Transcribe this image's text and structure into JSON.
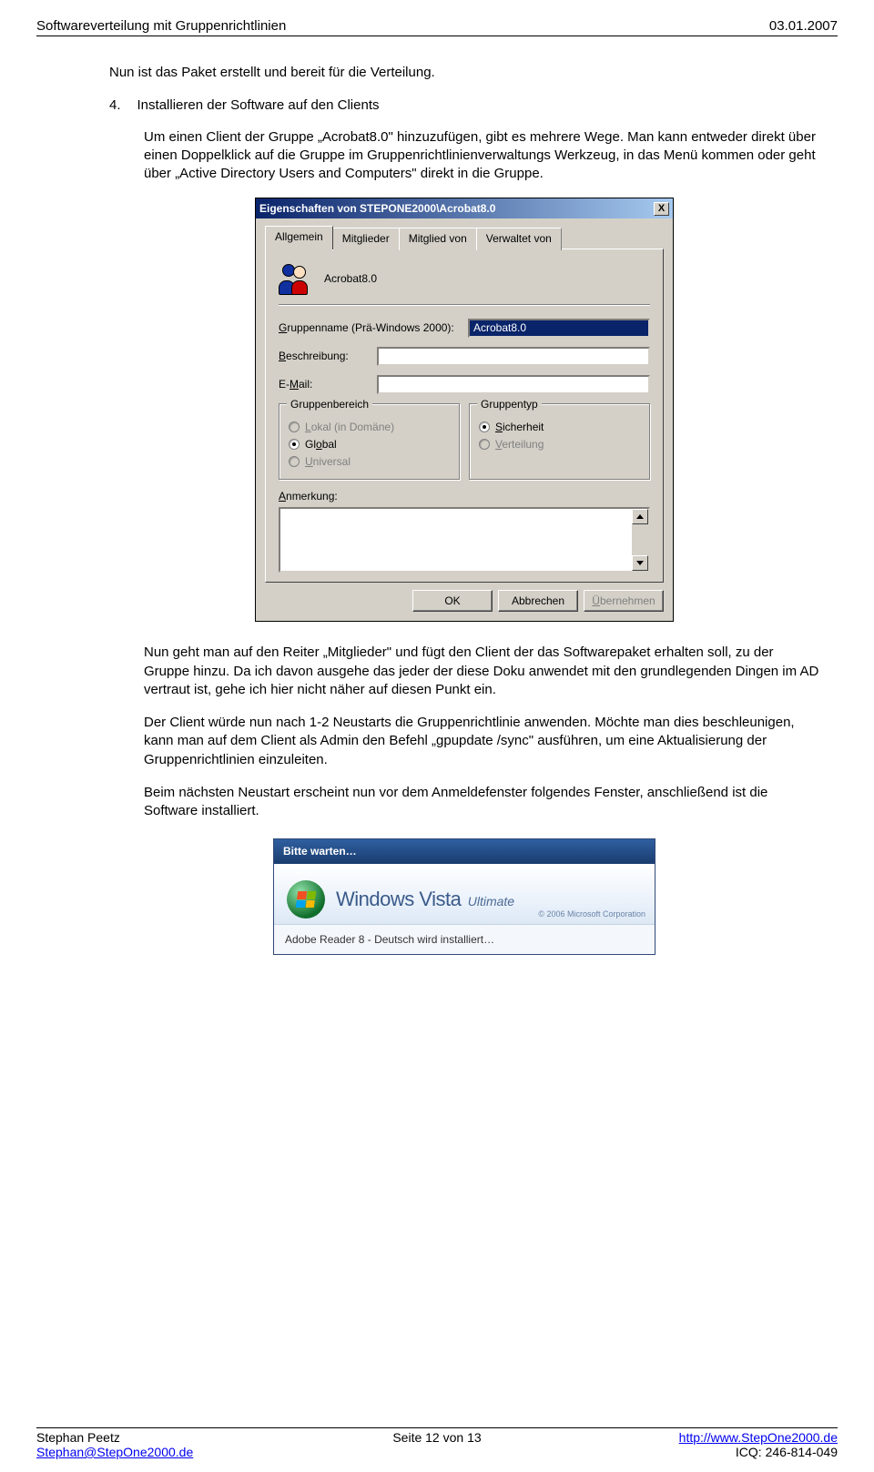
{
  "header": {
    "title": "Softwareverteilung mit Gruppenrichtlinien",
    "date": "03.01.2007"
  },
  "intro": "Nun ist das Paket erstellt und bereit für die Verteilung.",
  "section": {
    "num": "4.",
    "title": "Installieren der Software auf den Clients"
  },
  "p1": "Um einen Client der Gruppe „Acrobat8.0\" hinzuzufügen, gibt es mehrere Wege. Man kann entweder direkt über einen Doppelklick auf die Gruppe im Gruppenrichtlinienverwaltungs Werkzeug, in das Menü kommen oder geht über „Active Directory Users and Computers\" direkt in die Gruppe.",
  "dialog": {
    "title": "Eigenschaften von STEPONE2000\\Acrobat8.0",
    "close": "X",
    "tabs": {
      "t1": "Allgemein",
      "t2": "Mitglieder",
      "t3": "Mitglied von",
      "t4": "Verwaltet von"
    },
    "name": "Acrobat8.0",
    "labels": {
      "groupname": "Gruppenname (Prä-Windows 2000):",
      "desc": "Beschreibung:",
      "email": "E-Mail:",
      "scope": "Gruppenbereich",
      "type": "Gruppentyp",
      "note": "Anmerkung:"
    },
    "groupname_value": "Acrobat8.0",
    "desc_value": "",
    "email_value": "",
    "scope": {
      "local": "Lokal (in Domäne)",
      "global": "Global",
      "universal": "Universal"
    },
    "gtype": {
      "security": "Sicherheit",
      "distribution": "Verteilung"
    },
    "buttons": {
      "ok": "OK",
      "cancel": "Abbrechen",
      "apply": "Übernehmen"
    }
  },
  "p2": "Nun geht man auf den Reiter „Mitglieder\" und fügt den Client der das Softwarepaket erhalten soll, zu der Gruppe hinzu. Da ich davon ausgehe das jeder der diese Doku anwendet mit den grundlegenden Dingen im AD vertraut ist, gehe ich hier nicht näher auf diesen Punkt ein.",
  "p3": "Der Client würde nun nach 1-2 Neustarts die Gruppenrichtlinie anwenden. Möchte man dies beschleunigen, kann man auf dem Client als Admin den Befehl „gpupdate /sync\" ausführen, um eine Aktualisierung der Gruppenrichtlinien einzuleiten.",
  "p4": "Beim nächsten Neustart erscheint nun vor dem Anmeldefenster folgendes Fenster, anschließend ist die Software installiert.",
  "vista": {
    "title": "Bitte warten…",
    "brand1": "Windows Vista",
    "brand2": "Ultimate",
    "copy": "© 2006 Microsoft Corporation",
    "status": "Adobe Reader 8 - Deutsch wird installiert…"
  },
  "footer": {
    "l1": "Stephan Peetz",
    "l2": "Stephan@StepOne2000.de",
    "c1": "Seite 12 von 13",
    "r1": "http://www.StepOne2000.de",
    "r2": "ICQ: 246-814-049"
  }
}
